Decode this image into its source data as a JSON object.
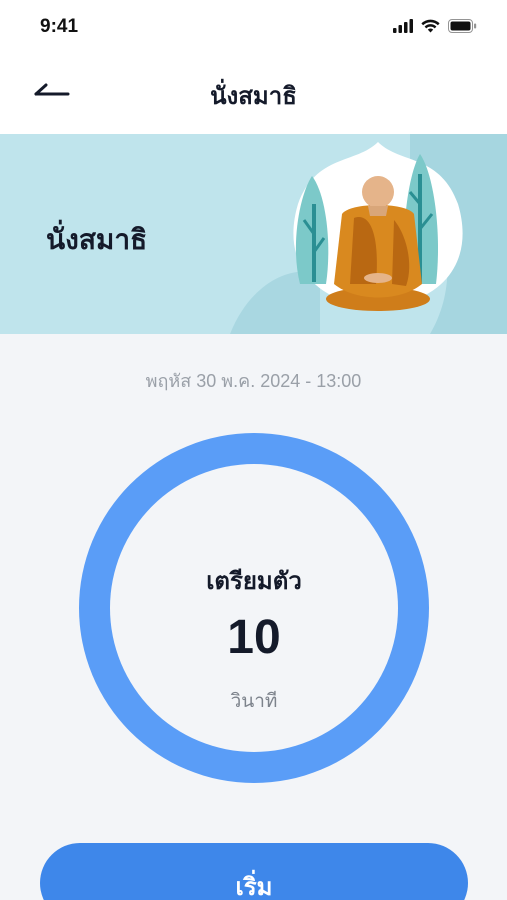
{
  "status_bar": {
    "time": "9:41",
    "icons": [
      "signal-icon",
      "wifi-icon",
      "battery-icon"
    ]
  },
  "nav": {
    "back_icon": "arrow-left-icon",
    "title": "นั่งสมาธิ"
  },
  "banner": {
    "title": "นั่งสมาธิ",
    "illustration": "meditating-monk-illustration"
  },
  "session": {
    "date": "พฤหัส 30 พ.ค. 2024 - 13:00"
  },
  "countdown": {
    "label": "เตรียมตัว",
    "value": "10",
    "unit": "วินาที"
  },
  "actions": {
    "start_label": "เริ่ม"
  },
  "colors": {
    "banner_bg": "#bfe4ec",
    "ring": "#5a9df7",
    "button": "#3e87ea",
    "background": "#f3f5f8"
  }
}
